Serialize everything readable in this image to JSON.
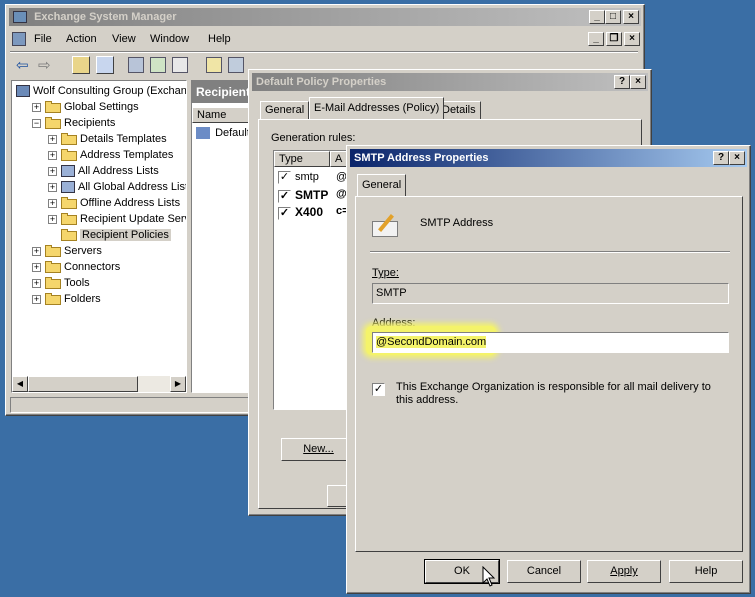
{
  "esm": {
    "title": "Exchange System Manager",
    "menu": [
      "File",
      "Action",
      "View",
      "Window",
      "Help"
    ],
    "tree": [
      {
        "label": "Wolf Consulting Group (Exchan",
        "level": 0,
        "expand": "",
        "icon": "org-icon"
      },
      {
        "label": "Global Settings",
        "level": 1,
        "expand": "+",
        "icon": "folder-icon"
      },
      {
        "label": "Recipients",
        "level": 1,
        "expand": "-",
        "icon": "folder-icon"
      },
      {
        "label": "Details Templates",
        "level": 2,
        "expand": "+",
        "icon": "folder-icon"
      },
      {
        "label": "Address Templates",
        "level": 2,
        "expand": "+",
        "icon": "folder-icon"
      },
      {
        "label": "All Address Lists",
        "level": 2,
        "expand": "+",
        "icon": "address-list-icon"
      },
      {
        "label": "All Global Address Lists",
        "level": 2,
        "expand": "+",
        "icon": "address-list-icon"
      },
      {
        "label": "Offline Address Lists",
        "level": 2,
        "expand": "+",
        "icon": "folder-icon"
      },
      {
        "label": "Recipient Update Servic",
        "level": 2,
        "expand": "+",
        "icon": "folder-icon"
      },
      {
        "label": "Recipient Policies",
        "level": 2,
        "expand": "",
        "icon": "open-folder-icon",
        "selected": true
      },
      {
        "label": "Servers",
        "level": 1,
        "expand": "+",
        "icon": "folder-icon"
      },
      {
        "label": "Connectors",
        "level": 1,
        "expand": "+",
        "icon": "folder-icon"
      },
      {
        "label": "Tools",
        "level": 1,
        "expand": "+",
        "icon": "folder-icon"
      },
      {
        "label": "Folders",
        "level": 1,
        "expand": "+",
        "icon": "folder-icon"
      }
    ],
    "right_header": "Recipient",
    "right_col": "Name",
    "right_row": "Default"
  },
  "policy": {
    "title": "Default Policy Properties",
    "tabs": [
      "General",
      "E-Mail Addresses (Policy)",
      "Details"
    ],
    "gen_rules_label": "Generation rules:",
    "col_type": "Type",
    "col_a": "A",
    "rows": [
      {
        "type": "smtp",
        "addr": "@",
        "bold": false
      },
      {
        "type": "SMTP",
        "addr": "@",
        "bold": true
      },
      {
        "type": "X400",
        "addr": "c=",
        "bold": true
      }
    ],
    "new_button": "New..."
  },
  "smtp": {
    "title": "SMTP Address Properties",
    "tab": "General",
    "heading": "SMTP Address",
    "type_label": "Type:",
    "type_value": "SMTP",
    "address_label": "Address:",
    "address_value": "@SecondDomain.com",
    "checkbox_label": "This Exchange Organization is responsible for all mail delivery to this address.",
    "checkbox_checked": true,
    "buttons": {
      "ok": "OK",
      "cancel": "Cancel",
      "apply": "Apply",
      "help": "Help"
    },
    "highlight_color": "#f4f36a"
  }
}
